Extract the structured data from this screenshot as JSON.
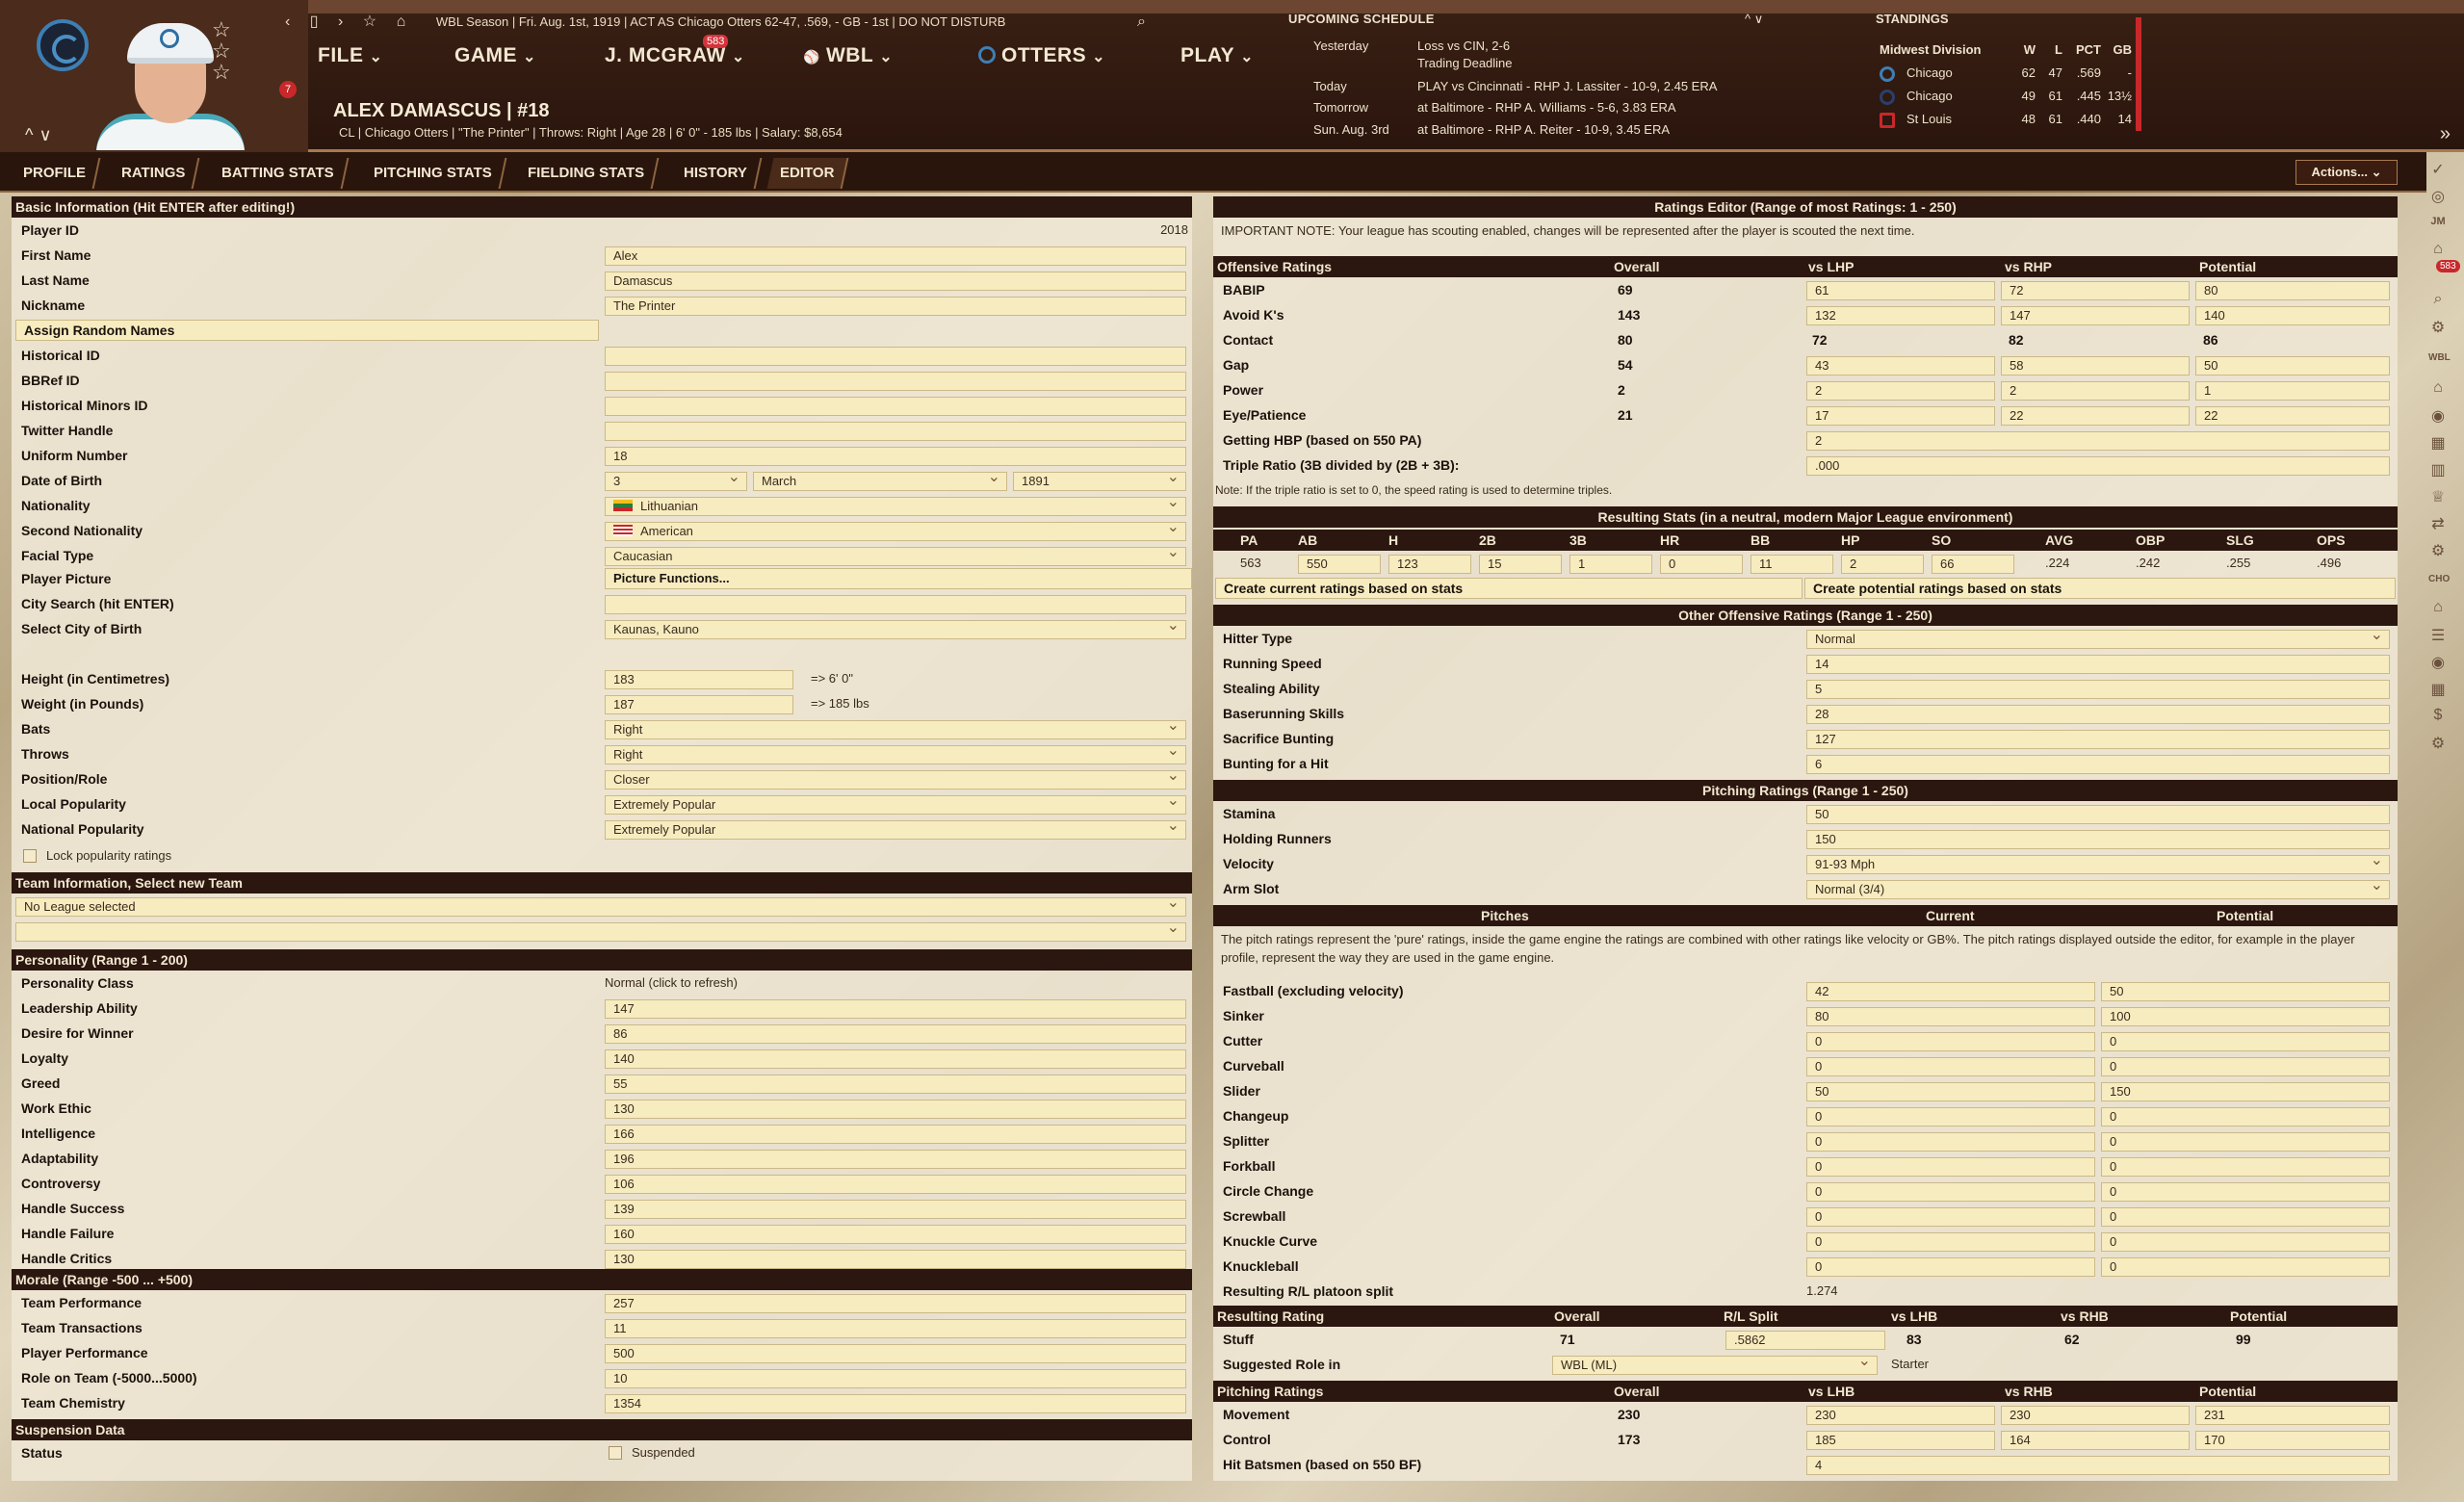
{
  "header": {
    "top_bar": "WBL Season | Fri. Aug. 1st, 1919 | ACT AS Chicago Otters 62-47, .569, - GB - 1st | DO NOT DISTURB",
    "nav": {
      "file": "FILE",
      "game": "GAME",
      "manager": "J. MCGRAW",
      "league": "WBL",
      "team": "OTTERS",
      "play": "PLAY",
      "mail_count": "583"
    },
    "player_name": "ALEX DAMASCUS | #18",
    "player_details": "CL | Chicago Otters | \"The Printer\" | Throws: Right | Age 28 | 6' 0\" - 185 lbs | Salary: $8,654",
    "alert_count": "7"
  },
  "schedule": {
    "title": "UPCOMING SCHEDULE",
    "rows": [
      {
        "day": "Yesterday",
        "text": "Loss vs CIN, 2-6"
      },
      {
        "day": "",
        "text": "Trading Deadline"
      },
      {
        "day": "Today",
        "text": "PLAY vs Cincinnati - RHP J. Lassiter - 10-9, 2.45 ERA"
      },
      {
        "day": "Tomorrow",
        "text": "at Baltimore - RHP A. Williams - 5-6, 3.83 ERA"
      },
      {
        "day": "Sun. Aug. 3rd",
        "text": "at Baltimore - RHP A. Reiter - 10-9, 3.45 ERA"
      }
    ]
  },
  "standings": {
    "title": "STANDINGS",
    "division": "Midwest Division",
    "cols": {
      "w": "W",
      "l": "L",
      "pct": "PCT",
      "gb": "GB"
    },
    "rows": [
      {
        "team": "Chicago",
        "w": "62",
        "l": "47",
        "pct": ".569",
        "gb": "-"
      },
      {
        "team": "Chicago",
        "w": "49",
        "l": "61",
        "pct": ".445",
        "gb": "13½"
      },
      {
        "team": "St Louis",
        "w": "48",
        "l": "61",
        "pct": ".440",
        "gb": "14"
      }
    ]
  },
  "tabs": [
    "PROFILE",
    "RATINGS",
    "BATTING STATS",
    "PITCHING STATS",
    "FIELDING STATS",
    "HISTORY",
    "EDITOR"
  ],
  "actions_label": "Actions...",
  "rail_badge": "583",
  "basic": {
    "header": "Basic Information (Hit ENTER after editing!)",
    "player_id_label": "Player ID",
    "player_id": "2018",
    "first_name_label": "First Name",
    "first_name": "Alex",
    "last_name_label": "Last Name",
    "last_name": "Damascus",
    "nickname_label": "Nickname",
    "nickname": "The Printer",
    "assign_random": "Assign Random Names",
    "historical_id_label": "Historical ID",
    "bbref_label": "BBRef ID",
    "hist_minors_label": "Historical Minors ID",
    "twitter_label": "Twitter Handle",
    "uniform_label": "Uniform Number",
    "uniform": "18",
    "dob_label": "Date of Birth",
    "dob_day": "3",
    "dob_month": "March",
    "dob_year": "1891",
    "nationality_label": "Nationality",
    "nationality": "Lithuanian",
    "second_nat_label": "Second Nationality",
    "second_nat": "American",
    "facial_label": "Facial Type",
    "facial": "Caucasian",
    "picture_label": "Player Picture",
    "picture_btn": "Picture Functions...",
    "city_search_label": "City Search (hit ENTER)",
    "city_birth_label": "Select City of Birth",
    "city_birth": "Kaunas, Kauno",
    "height_label": "Height (in Centimetres)",
    "height": "183",
    "height_conv": "=> 6' 0\"",
    "weight_label": "Weight (in Pounds)",
    "weight": "187",
    "weight_conv": "=> 185 lbs",
    "bats_label": "Bats",
    "bats": "Right",
    "throws_label": "Throws",
    "throws": "Right",
    "position_label": "Position/Role",
    "position": "Closer",
    "local_pop_label": "Local Popularity",
    "local_pop": "Extremely Popular",
    "national_pop_label": "National Popularity",
    "national_pop": "Extremely Popular",
    "lock_pop": "Lock popularity ratings"
  },
  "team_info": {
    "header": "Team Information, Select new Team",
    "league": "No League selected"
  },
  "personality": {
    "header": "Personality (Range 1 - 200)",
    "class_label": "Personality Class",
    "class": "Normal (click to refresh)",
    "rows": [
      {
        "label": "Leadership Ability",
        "value": "147"
      },
      {
        "label": "Desire for Winner",
        "value": "86"
      },
      {
        "label": "Loyalty",
        "value": "140"
      },
      {
        "label": "Greed",
        "value": "55"
      },
      {
        "label": "Work Ethic",
        "value": "130"
      },
      {
        "label": "Intelligence",
        "value": "166"
      },
      {
        "label": "Adaptability",
        "value": "196"
      },
      {
        "label": "Controversy",
        "value": "106"
      },
      {
        "label": "Handle Success",
        "value": "139"
      },
      {
        "label": "Handle Failure",
        "value": "160"
      },
      {
        "label": "Handle Critics",
        "value": "130"
      }
    ]
  },
  "morale": {
    "header": "Morale (Range -500 ... +500)",
    "rows": [
      {
        "label": "Team Performance",
        "value": "257"
      },
      {
        "label": "Team Transactions",
        "value": "11"
      },
      {
        "label": "Player Performance",
        "value": "500"
      },
      {
        "label": "Role on Team (-5000...5000)",
        "value": "10"
      },
      {
        "label": "Team Chemistry",
        "value": "1354"
      }
    ]
  },
  "suspension": {
    "header": "Suspension Data",
    "status_label": "Status",
    "suspended": "Suspended"
  },
  "ratings_editor": {
    "header": "Ratings Editor (Range of most Ratings: 1 - 250)",
    "note": "IMPORTANT NOTE: Your league has scouting enabled, changes will be represented after the player is scouted the next time.",
    "offensive_cols": {
      "name": "Offensive Ratings",
      "overall": "Overall",
      "lhp": "vs LHP",
      "rhp": "vs RHP",
      "pot": "Potential"
    },
    "offensive": [
      {
        "label": "BABIP",
        "overall": "69",
        "lhp": "61",
        "rhp": "72",
        "pot": "80"
      },
      {
        "label": "Avoid K's",
        "overall": "143",
        "lhp": "132",
        "rhp": "147",
        "pot": "140"
      },
      {
        "label": "Contact",
        "overall": "80",
        "lhp": "72",
        "rhp": "82",
        "pot": "86"
      },
      {
        "label": "Gap",
        "overall": "54",
        "lhp": "43",
        "rhp": "58",
        "pot": "50"
      },
      {
        "label": "Power",
        "overall": "2",
        "lhp": "2",
        "rhp": "2",
        "pot": "1"
      },
      {
        "label": "Eye/Patience",
        "overall": "21",
        "lhp": "17",
        "rhp": "22",
        "pot": "22"
      }
    ],
    "hbp_label": "Getting HBP (based on 550 PA)",
    "hbp": "2",
    "triple_label": "Triple Ratio (3B divided by (2B + 3B):",
    "triple": ".000",
    "triple_note": "Note: If the triple ratio is set to 0, the speed rating is used to determine triples.",
    "resulting_header": "Resulting Stats (in a neutral, modern Major League environment)",
    "stat_cols": [
      "PA",
      "AB",
      "H",
      "2B",
      "3B",
      "HR",
      "BB",
      "HP",
      "SO",
      "AVG",
      "OBP",
      "SLG",
      "OPS"
    ],
    "stat_vals": [
      "563",
      "550",
      "123",
      "15",
      "1",
      "0",
      "11",
      "2",
      "66",
      ".224",
      ".242",
      ".255",
      ".496"
    ],
    "create_current": "Create current ratings based on stats",
    "create_potential": "Create potential ratings based on stats",
    "other_header": "Other Offensive Ratings (Range 1 - 250)",
    "other": [
      {
        "label": "Hitter Type",
        "value": "Normal"
      },
      {
        "label": "Running Speed",
        "value": "14"
      },
      {
        "label": "Stealing Ability",
        "value": "5"
      },
      {
        "label": "Baserunning Skills",
        "value": "28"
      },
      {
        "label": "Sacrifice Bunting",
        "value": "127"
      },
      {
        "label": "Bunting for a Hit",
        "value": "6"
      }
    ],
    "pitching_header": "Pitching Ratings (Range 1 - 250)",
    "pitching": [
      {
        "label": "Stamina",
        "value": "50"
      },
      {
        "label": "Holding Runners",
        "value": "150"
      },
      {
        "label": "Velocity",
        "value": "91-93 Mph"
      },
      {
        "label": "Arm Slot",
        "value": "Normal (3/4)"
      }
    ],
    "pitches_cols": {
      "name": "Pitches",
      "current": "Current",
      "pot": "Potential"
    },
    "pitches_note": "The pitch ratings represent the 'pure' ratings, inside the game engine the ratings are combined with other ratings like velocity or GB%. The pitch ratings displayed outside the editor, for example in the player profile, represent the way they are used in the game engine.",
    "pitches": [
      {
        "label": "Fastball (excluding velocity)",
        "cur": "42",
        "pot": "50"
      },
      {
        "label": "Sinker",
        "cur": "80",
        "pot": "100"
      },
      {
        "label": "Cutter",
        "cur": "0",
        "pot": "0"
      },
      {
        "label": "Curveball",
        "cur": "0",
        "pot": "0"
      },
      {
        "label": "Slider",
        "cur": "50",
        "pot": "150"
      },
      {
        "label": "Changeup",
        "cur": "0",
        "pot": "0"
      },
      {
        "label": "Splitter",
        "cur": "0",
        "pot": "0"
      },
      {
        "label": "Forkball",
        "cur": "0",
        "pot": "0"
      },
      {
        "label": "Circle Change",
        "cur": "0",
        "pot": "0"
      },
      {
        "label": "Screwball",
        "cur": "0",
        "pot": "0"
      },
      {
        "label": "Knuckle Curve",
        "cur": "0",
        "pot": "0"
      },
      {
        "label": "Knuckleball",
        "cur": "0",
        "pot": "0"
      }
    ],
    "platoon_label": "Resulting R/L platoon split",
    "platoon": "1.274",
    "resulting_cols": {
      "name": "Resulting Rating",
      "overall": "Overall",
      "rl": "R/L Split",
      "lhb": "vs LHB",
      "rhb": "vs RHB",
      "pot": "Potential"
    },
    "stuff": {
      "label": "Stuff",
      "overall": "71",
      "rl": ".5862",
      "lhb": "83",
      "rhb": "62",
      "pot": "99"
    },
    "role_label": "Suggested Role in",
    "role_league": "WBL (ML)",
    "role": "Starter",
    "pr_cols": {
      "name": "Pitching Ratings",
      "overall": "Overall",
      "lhb": "vs LHB",
      "rhb": "vs RHB",
      "pot": "Potential"
    },
    "pr": [
      {
        "label": "Movement",
        "overall": "230",
        "lhb": "230",
        "rhb": "230",
        "pot": "231"
      },
      {
        "label": "Control",
        "overall": "173",
        "lhb": "185",
        "rhb": "164",
        "pot": "170"
      }
    ],
    "hit_batsmen_label": "Hit Batsmen (based on 550 BF)",
    "hit_batsmen": "4"
  }
}
